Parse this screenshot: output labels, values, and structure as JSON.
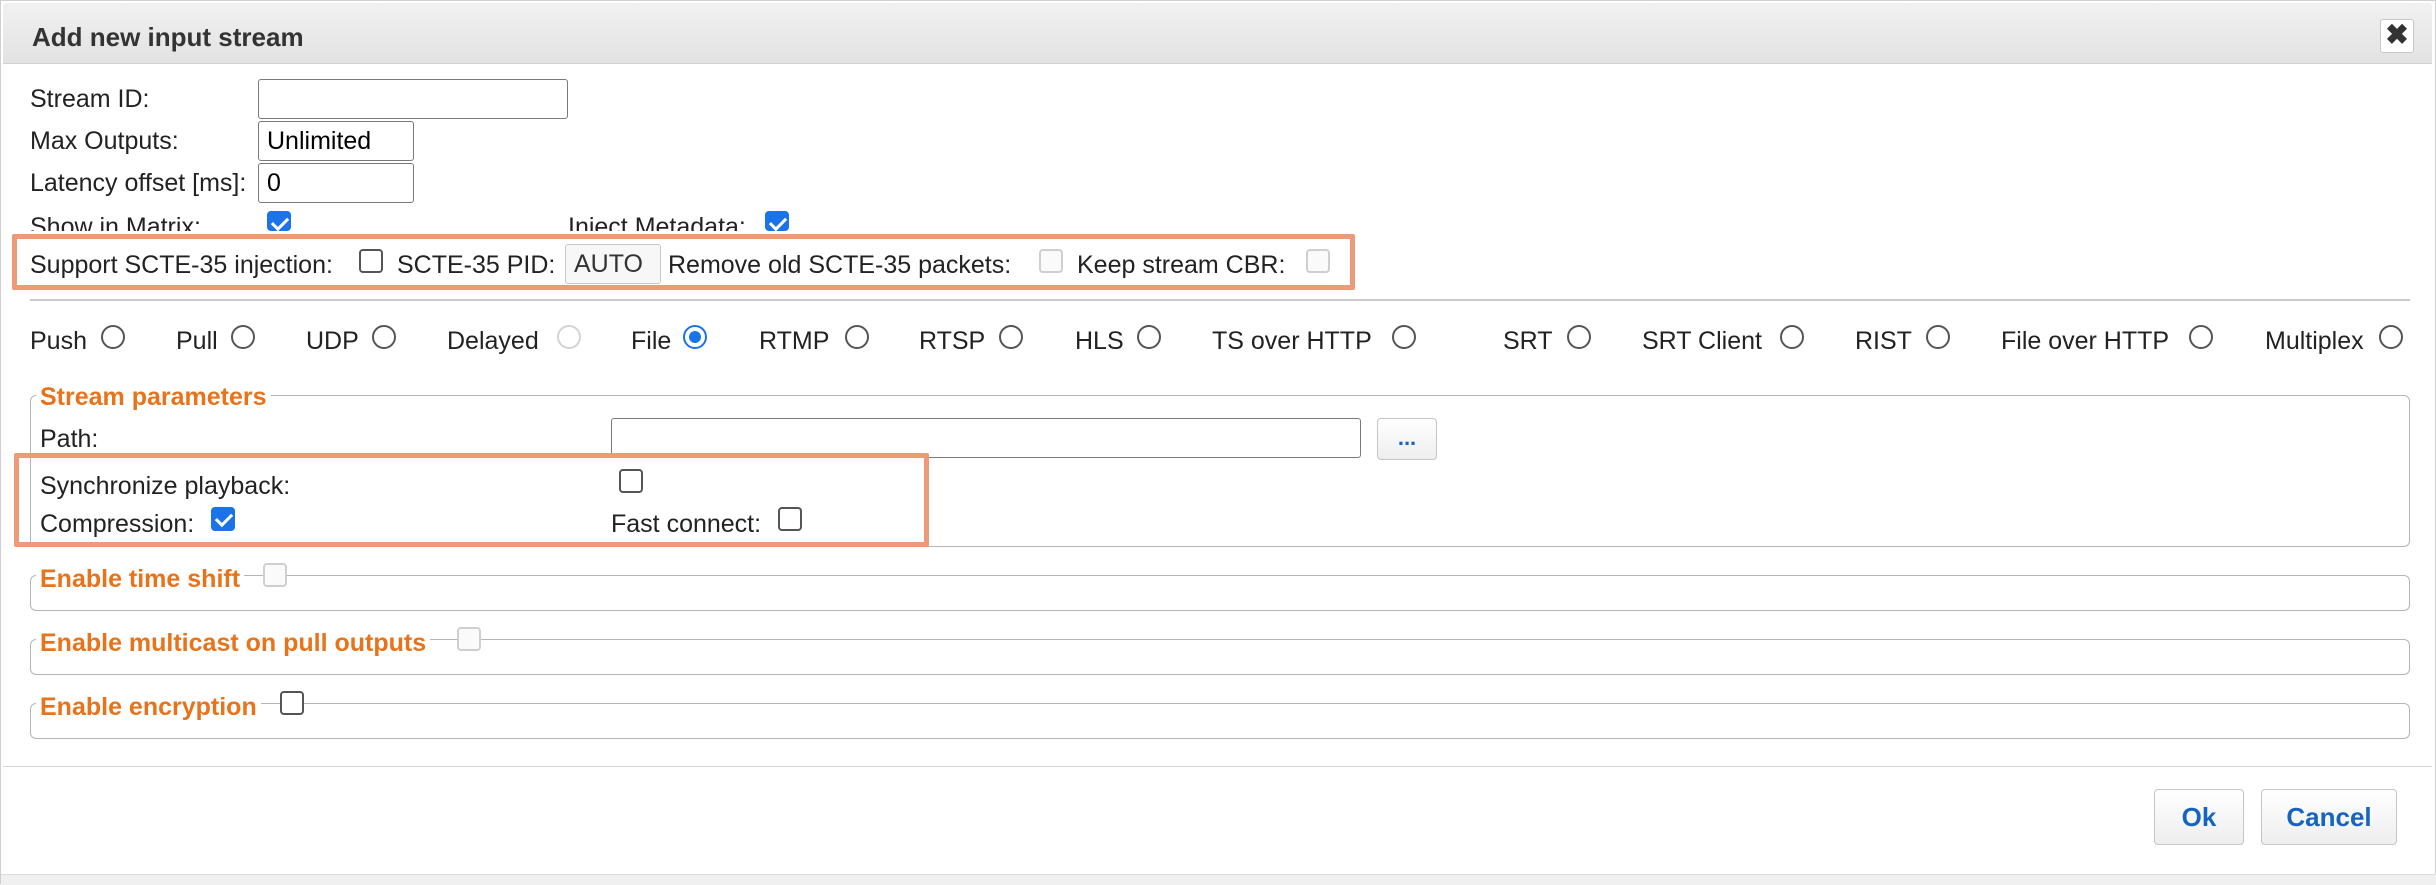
{
  "dialog": {
    "title": "Add new input stream",
    "close_glyph": "✖"
  },
  "fields": {
    "stream_id_label": "Stream ID:",
    "stream_id_value": "",
    "max_outputs_label": "Max Outputs:",
    "max_outputs_value": "Unlimited",
    "latency_label": "Latency offset [ms]:",
    "latency_value": "0",
    "show_in_matrix_label": "Show in Matrix:",
    "show_in_matrix_checked": true,
    "inject_metadata_label": "Inject Metadata:",
    "inject_metadata_checked": true
  },
  "scte": {
    "support_label": "Support SCTE-35 injection:",
    "support_checked": false,
    "pid_label": "SCTE-35 PID:",
    "pid_value": "AUTO",
    "remove_old_label": "Remove old SCTE-35 packets:",
    "keep_cbr_label": "Keep stream CBR:"
  },
  "input_types": [
    {
      "label": "Push",
      "selected": false,
      "disabled": false
    },
    {
      "label": "Pull",
      "selected": false,
      "disabled": false
    },
    {
      "label": "UDP",
      "selected": false,
      "disabled": false
    },
    {
      "label": "Delayed",
      "selected": false,
      "disabled": true
    },
    {
      "label": "File",
      "selected": true,
      "disabled": false
    },
    {
      "label": "RTMP",
      "selected": false,
      "disabled": false
    },
    {
      "label": "RTSP",
      "selected": false,
      "disabled": false
    },
    {
      "label": "HLS",
      "selected": false,
      "disabled": false
    },
    {
      "label": "TS over HTTP",
      "selected": false,
      "disabled": false
    },
    {
      "label": "SRT",
      "selected": false,
      "disabled": false
    },
    {
      "label": "SRT Client",
      "selected": false,
      "disabled": false
    },
    {
      "label": "RIST",
      "selected": false,
      "disabled": false
    },
    {
      "label": "File over HTTP",
      "selected": false,
      "disabled": false
    },
    {
      "label": "Multiplex",
      "selected": false,
      "disabled": false
    }
  ],
  "stream_params": {
    "legend": "Stream parameters",
    "path_label": "Path:",
    "path_value": "",
    "browse_label": "...",
    "sync_label": "Synchronize playback:",
    "sync_checked": false,
    "compression_label": "Compression:",
    "compression_checked": true,
    "fast_connect_label": "Fast connect:",
    "fast_connect_checked": false
  },
  "sections": {
    "time_shift": "Enable time shift",
    "multicast": "Enable multicast on pull outputs",
    "encryption": "Enable encryption"
  },
  "buttons": {
    "ok": "Ok",
    "cancel": "Cancel"
  },
  "colors": {
    "accent": "#1a73e8",
    "legend": "#e8731a",
    "highlight": "#ee9a78",
    "button_text": "#1565c0"
  }
}
